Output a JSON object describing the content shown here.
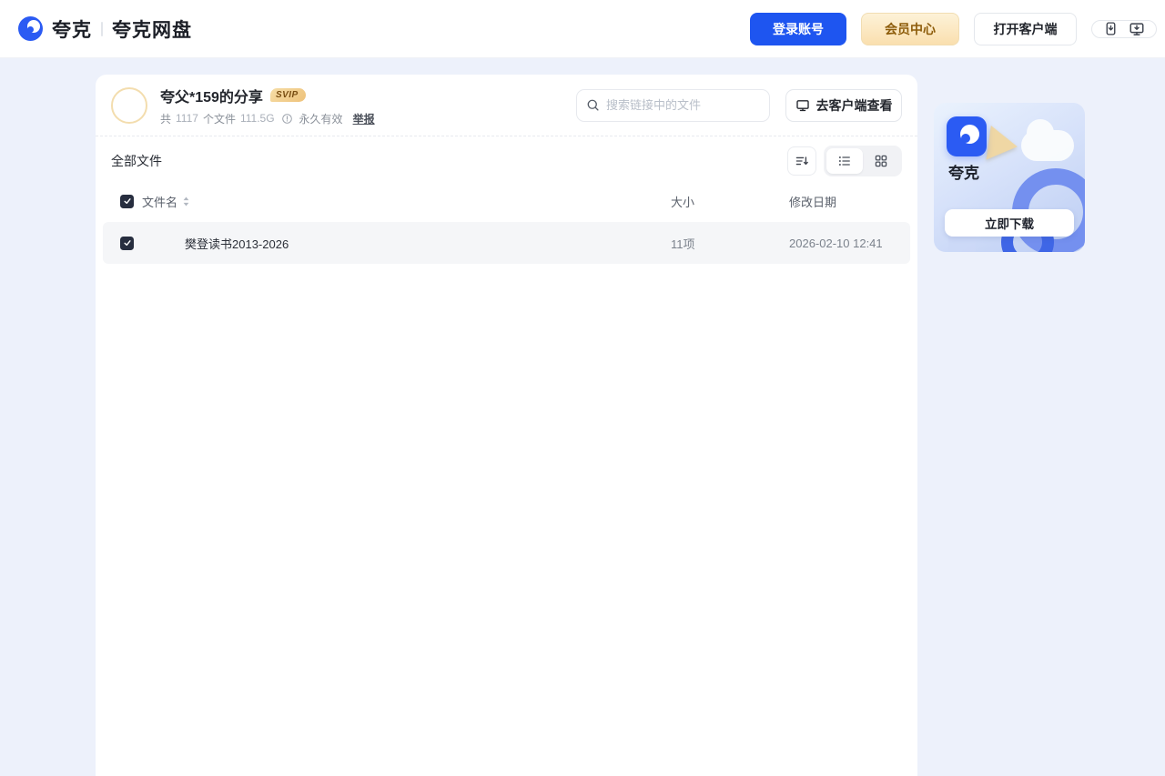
{
  "colors": {
    "accent_blue": "#1e55f0",
    "brand_blue": "#2b5bf3",
    "vip_text_gold": "#8d5c0a",
    "page_bg": "#edf1fb",
    "row_bg": "#f5f6f8"
  },
  "header": {
    "brand": "夸克",
    "brand_product": "夸克网盘",
    "login_button": "登录账号",
    "membership_button": "会员中心",
    "open_client_button": "打开客户端",
    "icons": [
      "phone-download-icon",
      "desktop-download-icon"
    ]
  },
  "share": {
    "title": "夸父*159的分享",
    "badge": "SVIP",
    "count_prefix": "共",
    "file_count": "1117",
    "count_suffix": "个文件",
    "total_size": "111.5G",
    "validity": "永久有效",
    "report": "举报",
    "search_placeholder": "搜索链接中的文件",
    "client_view_button": "去客户端查看"
  },
  "files": {
    "section_title": "全部文件",
    "columns": {
      "name": "文件名",
      "size": "大小",
      "modified": "修改日期"
    },
    "rows": [
      {
        "name": "樊登读书2013-2026",
        "size": "11项",
        "modified": "2026-02-10 12:41",
        "checked": true
      }
    ]
  },
  "promo": {
    "app_name": "夸克",
    "download_button": "立即下载"
  }
}
